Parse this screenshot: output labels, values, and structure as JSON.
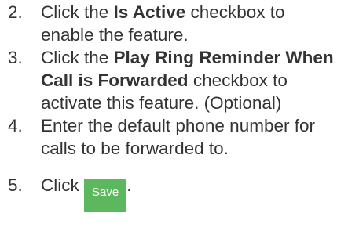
{
  "steps": [
    {
      "number": "2.",
      "pre": "Click the ",
      "bold": "Is Active",
      "post": " checkbox to enable the feature."
    },
    {
      "number": "3.",
      "pre": "Click the ",
      "bold": "Play Ring Reminder When Call is Forwarded",
      "post": " checkbox to activate this feature. (Optional)"
    },
    {
      "number": "4.",
      "text": "Enter the default phone number for calls to be forwarded to."
    },
    {
      "number": "5.",
      "pre": "Click ",
      "button_label": "Save",
      "post": "."
    }
  ],
  "colors": {
    "text": "#333333",
    "save_button_bg": "#5cb85c",
    "save_button_text": "#ffffff"
  }
}
